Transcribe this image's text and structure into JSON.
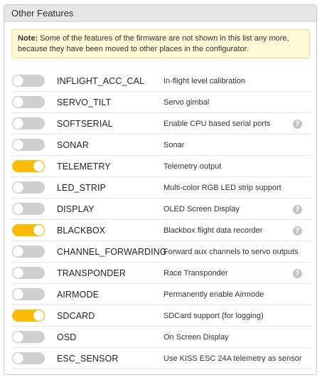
{
  "panel": {
    "title": "Other Features",
    "note_label": "Note:",
    "note_text": " Some of the features of the firmware are not shown in this list any more, because they have been moved to other places in the configurator."
  },
  "colors": {
    "toggle_on": "#ffbb00",
    "toggle_off": "#cfcfcf",
    "note_bg": "#fff9d6"
  },
  "features": [
    {
      "name": "INFLIGHT_ACC_CAL",
      "description": "In-flight level calibration",
      "enabled": false,
      "help": false
    },
    {
      "name": "SERVO_TILT",
      "description": "Servo gimbal",
      "enabled": false,
      "help": false
    },
    {
      "name": "SOFTSERIAL",
      "description": "Enable CPU based serial ports",
      "enabled": false,
      "help": true
    },
    {
      "name": "SONAR",
      "description": "Sonar",
      "enabled": false,
      "help": false
    },
    {
      "name": "TELEMETRY",
      "description": "Telemetry output",
      "enabled": true,
      "help": false
    },
    {
      "name": "LED_STRIP",
      "description": "Multi-color RGB LED strip support",
      "enabled": false,
      "help": false
    },
    {
      "name": "DISPLAY",
      "description": "OLED Screen Display",
      "enabled": false,
      "help": true
    },
    {
      "name": "BLACKBOX",
      "description": "Blackbox flight data recorder",
      "enabled": true,
      "help": true
    },
    {
      "name": "CHANNEL_FORWARDING",
      "description": "Forward aux channels to servo outputs",
      "enabled": false,
      "help": false
    },
    {
      "name": "TRANSPONDER",
      "description": "Race Transponder",
      "enabled": false,
      "help": true
    },
    {
      "name": "AIRMODE",
      "description": "Permanently enable Airmode",
      "enabled": false,
      "help": false
    },
    {
      "name": "SDCARD",
      "description": "SDCard support (for logging)",
      "enabled": true,
      "help": false
    },
    {
      "name": "OSD",
      "description": "On Screen Display",
      "enabled": false,
      "help": false
    },
    {
      "name": "ESC_SENSOR",
      "description": "Use KISS ESC 24A telemetry as sensor",
      "enabled": false,
      "help": false
    }
  ],
  "help_glyph": "?"
}
